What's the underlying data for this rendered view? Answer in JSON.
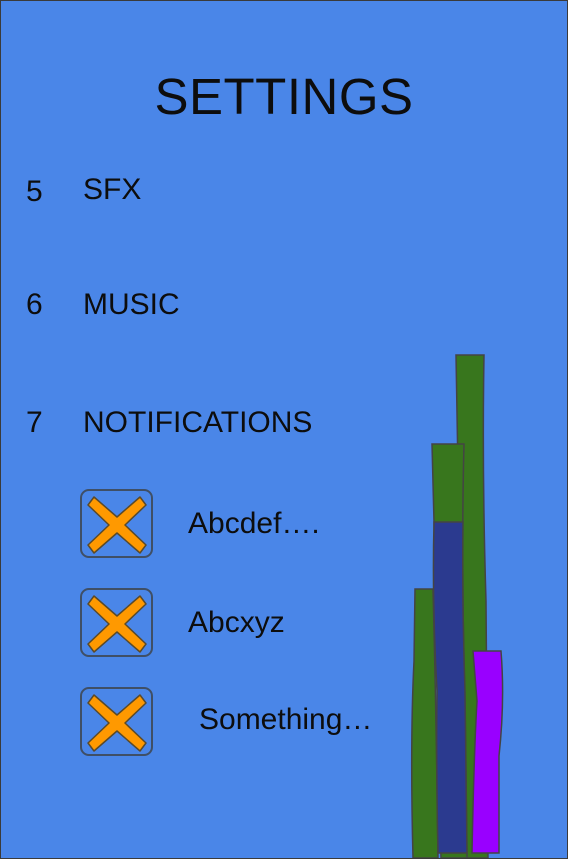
{
  "screen": {
    "title": "SETTINGS",
    "background_color": "#4a86e8"
  },
  "settings": [
    {
      "number": "5",
      "label": "SFX"
    },
    {
      "number": "6",
      "label": "MUSIC"
    },
    {
      "number": "7",
      "label": "NOTIFICATIONS"
    }
  ],
  "notification_options": [
    {
      "label": "Abcdef….",
      "icon": "x-icon",
      "checked": true
    },
    {
      "label": "Abcxyz",
      "icon": "x-icon",
      "checked": true
    },
    {
      "label": "Something…",
      "icon": "x-icon",
      "checked": true
    }
  ],
  "colors": {
    "x_fill": "#ff9900",
    "bar_green": "#38761d",
    "bar_navy": "#2b3a8f",
    "bar_purple": "#9900ff"
  }
}
